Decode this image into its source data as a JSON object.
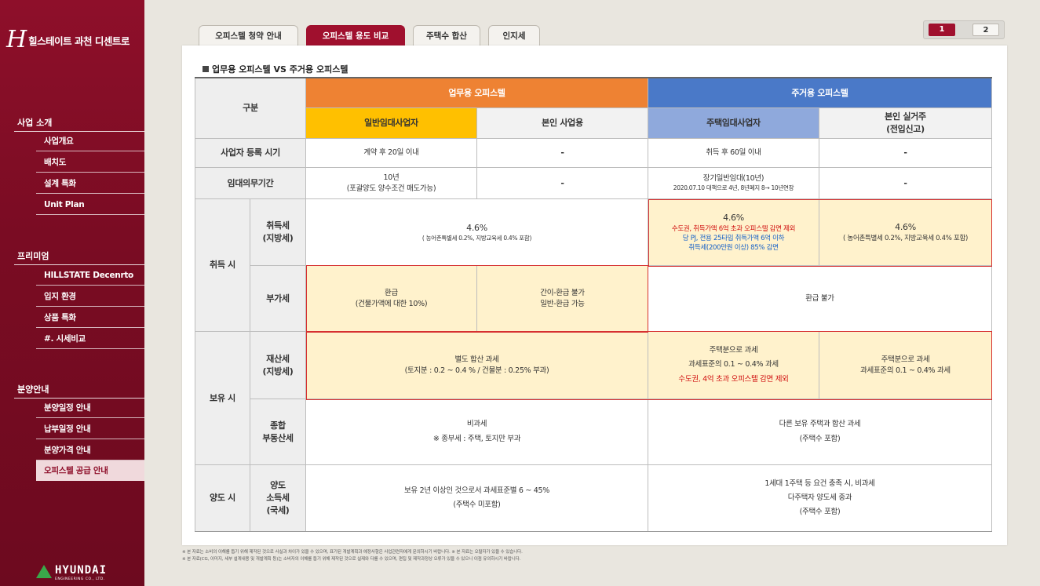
{
  "sidebar": {
    "logo_mark": "H",
    "logo_text": "힐스테이트 과천 디센트로",
    "sections": [
      {
        "title": "사업 소개",
        "items": [
          "사업개요",
          "배치도",
          "설계 특화",
          "Unit Plan"
        ]
      },
      {
        "title": "프리미엄",
        "items": [
          "HILLSTATE Decenrto",
          "입지 환경",
          "상품 특화",
          "#. 시세비교"
        ]
      },
      {
        "title": "분양안내",
        "items": [
          "분양일정 안내",
          "납부일정 안내",
          "분양가격 안내",
          "오피스텔 공급 안내"
        ]
      }
    ],
    "brand": "HYUNDAI",
    "brand_sub": "ENGINEERING CO., LTD."
  },
  "tabs": [
    "오피스텔 청약 안내",
    "오피스텔 용도 비교",
    "주택수 합산",
    "인지세"
  ],
  "active_tab": 1,
  "pager": [
    "1",
    "2"
  ],
  "section_title": "업무용 오피스텔 VS 주거용 오피스텔",
  "table": {
    "h_gubun": "구분",
    "h_business": "업무용 오피스텔",
    "h_residential": "주거용 오피스텔",
    "h_sub1": "일반임대사업자",
    "h_sub2": "본인 사업용",
    "h_sub3": "주택임대사업자",
    "h_sub4a": "본인 실거주",
    "h_sub4b": "(전입신고)",
    "r1_label": "사업자 등록 시기",
    "r1_c1": "계약 후 20일 이내",
    "r1_c2": "-",
    "r1_c3": "취득 후 60일 이내",
    "r1_c4": "-",
    "r2_label": "임대의무기간",
    "r2_c1a": "10년",
    "r2_c1b": "(포괄양도 양수조건 매도가능)",
    "r2_c2": "-",
    "r2_c3a": "장기일반임대(10년)",
    "r2_c3b": "2020.07.10 대책으로 4년, 8년폐지 8→ 10년연장",
    "r2_c4": "-",
    "acq_label": "취득 시",
    "acq1_a": "취득세",
    "acq1_b": "(지방세)",
    "acq1_c12a": "4.6%",
    "acq1_c12b": "( 농어촌특별세 0.2%, 지방교육세 0.4% 포함)",
    "acq1_c3a": "4.6%",
    "acq1_c3b": "수도권, 취득가액 6억 초과 오피스텔 감면 제외",
    "acq1_c3c": "당 PJ, 전용 25타입 취득가액 6억 이하",
    "acq1_c3d": "취득세(200만원 이상) 85% 감면",
    "acq1_c4a": "4.6%",
    "acq1_c4b": "( 농어촌특별세 0.2%, 지방교육세 0.4% 포함)",
    "acq2_label": "부가세",
    "acq2_c1a": "환급",
    "acq2_c1b": "(건물가액에 대한 10%)",
    "acq2_c2a": "간이-환급 불가",
    "acq2_c2b": "일반-환급 가능",
    "acq2_c34": "환급 불가",
    "hold_label": "보유 시",
    "hold1_a": "재산세",
    "hold1_b": "(지방세)",
    "hold1_c12a": "별도 합산 과세",
    "hold1_c12b": "(토지분 : 0.2 ~ 0.4 %  / 건물분 : 0.25% 부과)",
    "hold1_c3a": "주택분으로 과세",
    "hold1_c3b": "과세표준의 0.1 ~ 0.4% 과세",
    "hold1_c3c": "수도권, 4억 초과 오피스텔 감면 제외",
    "hold1_c4a": "주택분으로 과세",
    "hold1_c4b": "과세표준의 0.1 ~ 0.4% 과세",
    "hold2_a": "종합",
    "hold2_b": "부동산세",
    "hold2_c12a": "비과세",
    "hold2_c12b": "※ 종부세 : 주택, 토지만 부과",
    "hold2_c34a": "다른 보유 주택과 합산 과세",
    "hold2_c34b": "(주택수 포함)",
    "trans_label": "양도 시",
    "trans_a": "양도",
    "trans_b": "소득세",
    "trans_c": "(국세)",
    "trans_c12a": "보유 2년 이상인 것으로서 과세표준별 6 ~ 45%",
    "trans_c12b": "(주택수 미포함)",
    "trans_c34a": "1세대 1주택 등 요건 충족 시, 비과세",
    "trans_c34b": "다주택자 양도세 중과",
    "trans_c34c": "(주택수 포함)"
  },
  "footnotes": [
    "※ 본 자료는 소비의 이해를 돕기 위해 제작된 것으로 사실과 차이가 있을 수 있으며, 표기된 개발계획과 예정사항은 사업관련자에게 문의하시기 바랍니다.    ※ 본 자료는 오탈자가 있을 수 있습니다.",
    "※ 본 자료(CG, 이미지, 세부 설계내용 및 개발계획 등)는 소비자의 이해를 돕기 위해 제작된 것으로 실제와 다를 수 있으며, 편집 및 제작과정상 오류가 있을 수 있으니 이점 유의하시기 바랍니다."
  ],
  "colors": {
    "brand": "#8e0f2a",
    "orange": "#ee8233",
    "blue": "#4a79c8",
    "yellow": "#ffc000",
    "light_blue": "#8fa9dc",
    "cream": "#fff2cc",
    "red_text": "#d01010"
  }
}
